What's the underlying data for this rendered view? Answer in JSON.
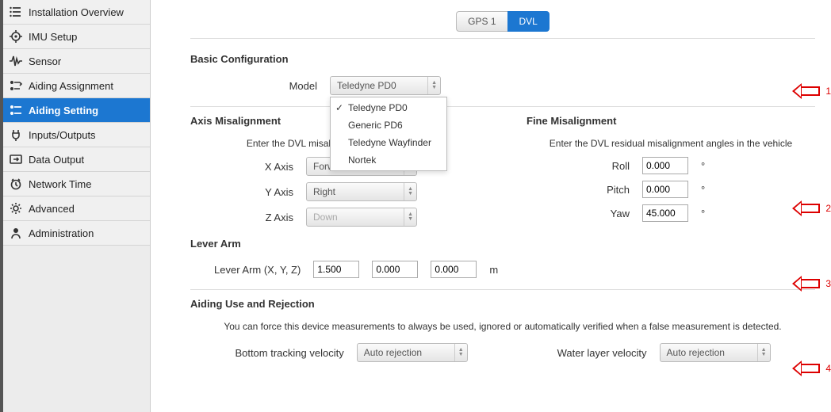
{
  "sidebar": {
    "items": [
      {
        "label": "Installation Overview"
      },
      {
        "label": "IMU Setup"
      },
      {
        "label": "Sensor"
      },
      {
        "label": "Aiding Assignment"
      },
      {
        "label": "Aiding Setting",
        "active": true
      },
      {
        "label": "Inputs/Outputs"
      },
      {
        "label": "Data Output"
      },
      {
        "label": "Network Time"
      },
      {
        "label": "Advanced"
      },
      {
        "label": "Administration"
      }
    ]
  },
  "tabs": {
    "gps1": "GPS 1",
    "dvl": "DVL"
  },
  "sections": {
    "basic": {
      "title": "Basic Configuration",
      "model_label": "Model",
      "model_value": "Teledyne PD0",
      "model_options": [
        "Teledyne PD0",
        "Generic PD6",
        "Teledyne Wayfinder",
        "Nortek"
      ]
    },
    "axis": {
      "title": "Axis Misalignment",
      "hint": "Enter the DVL misalignment in the vehicle",
      "x_label": "X Axis",
      "x_value": "Forward",
      "y_label": "Y Axis",
      "y_value": "Right",
      "z_label": "Z Axis",
      "z_value": "Down"
    },
    "fine": {
      "title": "Fine Misalignment",
      "hint": "Enter the DVL residual misalignment angles in the vehicle",
      "roll_label": "Roll",
      "roll_value": "0.000",
      "pitch_label": "Pitch",
      "pitch_value": "0.000",
      "yaw_label": "Yaw",
      "yaw_value": "45.000",
      "unit": "°"
    },
    "lever": {
      "title": "Lever Arm",
      "label": "Lever Arm (X, Y, Z)",
      "x": "1.500",
      "y": "0.000",
      "z": "0.000",
      "unit": "m"
    },
    "rejection": {
      "title": "Aiding Use and Rejection",
      "hint": "You can force this device measurements to always be used, ignored or automatically verified when a false measurement is detected.",
      "bottom_label": "Bottom tracking velocity",
      "bottom_value": "Auto rejection",
      "water_label": "Water layer velocity",
      "water_value": "Auto rejection"
    }
  },
  "annots": {
    "a1": "1",
    "a2": "2",
    "a3": "3",
    "a4": "4"
  }
}
